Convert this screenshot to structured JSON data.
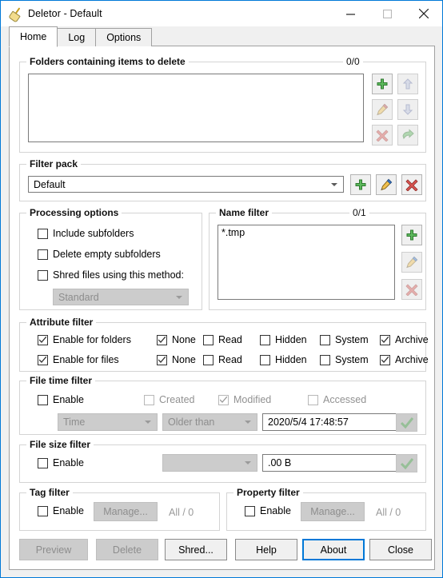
{
  "window": {
    "title": "Deletor - Default",
    "icon": "broom-icon",
    "accent": "#0078d7",
    "controls": {
      "minimize": "minimize-icon",
      "maximize": "maximize-icon",
      "close": "close-icon"
    }
  },
  "tabs": [
    {
      "label": "Home",
      "active": true
    },
    {
      "label": "Log",
      "active": false
    },
    {
      "label": "Options",
      "active": false
    }
  ],
  "folders_group": {
    "legend": "Folders containing items to delete",
    "counter": "0/0",
    "items": [],
    "buttons": [
      {
        "name": "add-folder-button",
        "icon": "plus-icon",
        "enabled": true
      },
      {
        "name": "move-up-button",
        "icon": "arrow-up-icon",
        "enabled": false
      },
      {
        "name": "edit-folder-button",
        "icon": "pencil-icon",
        "enabled": false
      },
      {
        "name": "move-down-button",
        "icon": "arrow-down-icon",
        "enabled": false
      },
      {
        "name": "remove-folder-button",
        "icon": "cross-icon",
        "enabled": false
      },
      {
        "name": "open-folder-button",
        "icon": "arrow-right-icon",
        "enabled": false
      }
    ]
  },
  "filter_pack": {
    "legend": "Filter pack",
    "selected": "Default",
    "buttons": [
      {
        "name": "add-filter-pack-button",
        "icon": "plus-icon",
        "enabled": true
      },
      {
        "name": "edit-filter-pack-button",
        "icon": "pencil-icon",
        "enabled": true
      },
      {
        "name": "delete-filter-pack-button",
        "icon": "cross-icon",
        "enabled": true
      }
    ]
  },
  "processing_options": {
    "legend": "Processing options",
    "include_subfolders": {
      "label": "Include subfolders",
      "checked": false
    },
    "delete_empty_subfolders": {
      "label": "Delete empty subfolders",
      "checked": false
    },
    "shred_files": {
      "label": "Shred files using this method:",
      "checked": false
    },
    "shred_method": {
      "value": "Standard",
      "enabled": false
    }
  },
  "name_filter": {
    "legend": "Name filter",
    "counter": "0/1",
    "items": [
      "*.tmp"
    ],
    "buttons": [
      {
        "name": "add-name-filter-button",
        "icon": "plus-icon",
        "enabled": true
      },
      {
        "name": "edit-name-filter-button",
        "icon": "pencil-icon",
        "enabled": false
      },
      {
        "name": "remove-name-filter-button",
        "icon": "cross-icon",
        "enabled": false
      }
    ]
  },
  "attribute_filter": {
    "legend": "Attribute filter",
    "rows": [
      {
        "enable": {
          "label": "Enable for folders",
          "checked": true
        },
        "flags": [
          {
            "label": "None",
            "checked": true
          },
          {
            "label": "Read",
            "checked": false
          },
          {
            "label": "Hidden",
            "checked": false
          },
          {
            "label": "System",
            "checked": false
          },
          {
            "label": "Archive",
            "checked": true
          }
        ]
      },
      {
        "enable": {
          "label": "Enable for files",
          "checked": true
        },
        "flags": [
          {
            "label": "None",
            "checked": true
          },
          {
            "label": "Read",
            "checked": false
          },
          {
            "label": "Hidden",
            "checked": false
          },
          {
            "label": "System",
            "checked": false
          },
          {
            "label": "Archive",
            "checked": true
          }
        ]
      }
    ]
  },
  "file_time_filter": {
    "legend": "File time filter",
    "enable": {
      "label": "Enable",
      "checked": false
    },
    "created": {
      "label": "Created",
      "checked": false,
      "enabled": false
    },
    "modified": {
      "label": "Modified",
      "checked": true,
      "enabled": false
    },
    "accessed": {
      "label": "Accessed",
      "checked": false,
      "enabled": false
    },
    "mode": {
      "value": "Time",
      "enabled": false
    },
    "comparison": {
      "value": "Older than",
      "enabled": false
    },
    "datetime": {
      "value": "2020/5/4 17:48:57",
      "enabled": true
    },
    "apply_button": {
      "icon": "check-icon",
      "enabled": false
    }
  },
  "file_size_filter": {
    "legend": "File size filter",
    "enable": {
      "label": "Enable",
      "checked": false
    },
    "comparison": {
      "value": "",
      "enabled": false
    },
    "size": {
      "value": ".00 B",
      "enabled": true
    },
    "apply_button": {
      "icon": "check-icon",
      "enabled": false
    }
  },
  "tag_filter": {
    "legend": "Tag filter",
    "enable": {
      "label": "Enable",
      "checked": false
    },
    "manage_label": "Manage...",
    "count": "All / 0"
  },
  "property_filter": {
    "legend": "Property filter",
    "enable": {
      "label": "Enable",
      "checked": false
    },
    "manage_label": "Manage...",
    "count": "All / 0"
  },
  "footer": {
    "buttons": [
      {
        "label": "Preview",
        "enabled": false,
        "focused": false
      },
      {
        "label": "Delete",
        "enabled": false,
        "focused": false
      },
      {
        "label": "Shred...",
        "enabled": true,
        "focused": false
      },
      {
        "label": "Help",
        "enabled": true,
        "focused": false
      },
      {
        "label": "About",
        "enabled": true,
        "focused": true
      },
      {
        "label": "Close",
        "enabled": true,
        "focused": false
      }
    ]
  }
}
